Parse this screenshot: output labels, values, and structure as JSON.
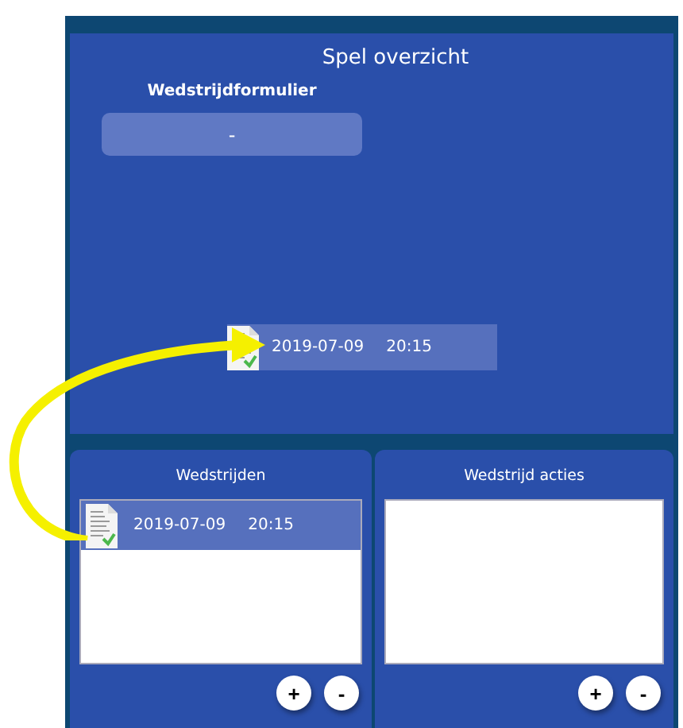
{
  "title": "Spel overzicht",
  "form": {
    "label": "Wedstrijdformulier",
    "value": "-"
  },
  "drag_item": {
    "date": "2019-07-09",
    "time": "20:15"
  },
  "matches": {
    "title": "Wedstrijden",
    "rows": [
      {
        "date": "2019-07-09",
        "time": "20:15",
        "selected": true
      }
    ],
    "buttons": [
      "+",
      "-"
    ]
  },
  "actions": {
    "title": "Wedstrijd acties",
    "buttons": [
      "+",
      "-"
    ]
  }
}
